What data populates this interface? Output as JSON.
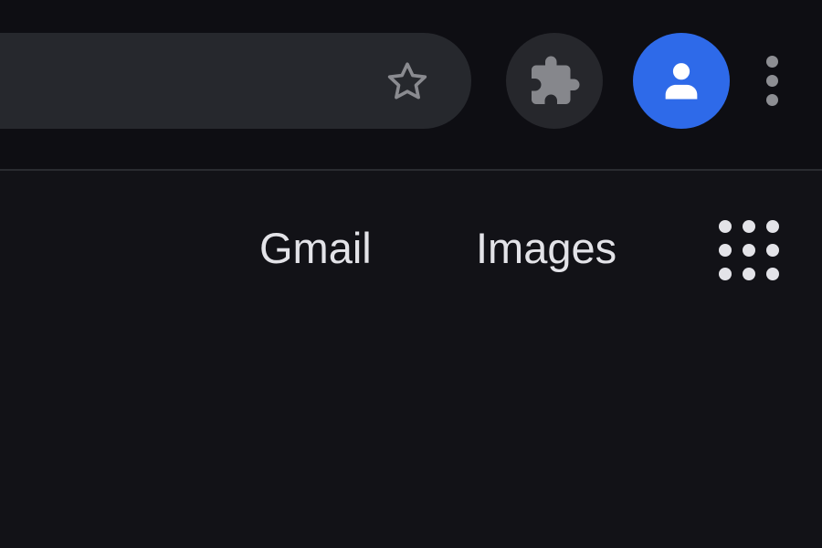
{
  "browser": {
    "icons": {
      "bookmark": "star-icon",
      "extensions": "puzzle-icon",
      "profile": "person-icon",
      "menu": "vertical-dots-icon"
    },
    "colors": {
      "toolbar_bg": "#0e0e13",
      "omnibox_bg": "#26282d",
      "profile_accent": "#2e6ae9",
      "page_bg": "#121217"
    }
  },
  "header": {
    "links": [
      {
        "label": "Gmail"
      },
      {
        "label": "Images"
      }
    ],
    "apps_icon": "apps-grid-icon",
    "text_color": "#e3e3e8"
  }
}
